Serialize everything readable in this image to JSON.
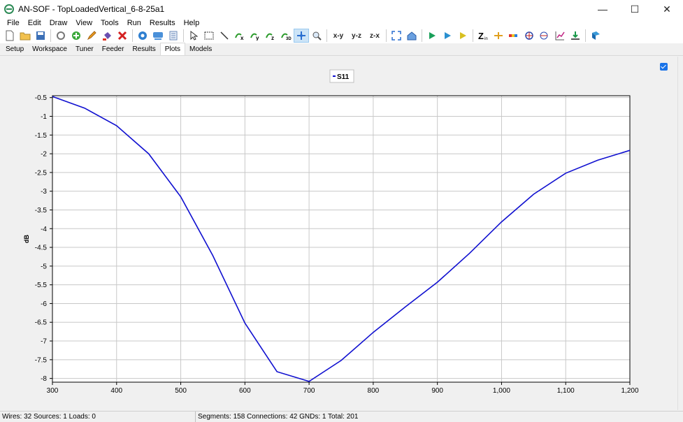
{
  "window": {
    "title": "AN-SOF - TopLoadedVertical_6-8-25a1"
  },
  "window_controls": {
    "minimize": "—",
    "maximize": "☐",
    "close": "✕"
  },
  "menu": [
    "File",
    "Edit",
    "Draw",
    "View",
    "Tools",
    "Run",
    "Results",
    "Help"
  ],
  "toolbar_text": {
    "xy": "x-y",
    "yz": "y-z",
    "zx": "z-x"
  },
  "tabs": [
    "Setup",
    "Workspace",
    "Tuner",
    "Feeder",
    "Results",
    "Plots",
    "Models"
  ],
  "active_tab": "Plots",
  "status": {
    "left": "Wires: 32  Sources: 1  Loads: 0",
    "right": "Segments: 158  Connections: 42  GNDs: 1  Total: 201"
  },
  "chart_data": {
    "type": "line",
    "title": "",
    "xlabel": "",
    "ylabel": "dB",
    "legend": "S11",
    "legend_position": "top-center",
    "grid": true,
    "xlim": [
      300,
      1200
    ],
    "ylim": [
      -8.1,
      -0.45
    ],
    "x_ticks": [
      "300",
      "400",
      "500",
      "600",
      "700",
      "800",
      "900",
      "1,000",
      "1,100",
      "1,200"
    ],
    "x_tick_values": [
      300,
      400,
      500,
      600,
      700,
      800,
      900,
      1000,
      1100,
      1200
    ],
    "y_ticks": [
      "-0.5",
      "-1",
      "-1.5",
      "-2",
      "-2.5",
      "-3",
      "-3.5",
      "-4",
      "-4.5",
      "-5",
      "-5.5",
      "-6",
      "-6.5",
      "-7",
      "-7.5",
      "-8"
    ],
    "y_tick_values": [
      -0.5,
      -1,
      -1.5,
      -2,
      -2.5,
      -3,
      -3.5,
      -4,
      -4.5,
      -5,
      -5.5,
      -6,
      -6.5,
      -7,
      -7.5,
      -8
    ],
    "series": [
      {
        "name": "S11",
        "color": "#1010d0",
        "x": [
          300,
          350,
          400,
          450,
          500,
          550,
          600,
          650,
          700,
          750,
          800,
          850,
          900,
          950,
          1000,
          1050,
          1100,
          1150,
          1200
        ],
        "values": [
          -0.47,
          -0.78,
          -1.25,
          -2.0,
          -3.15,
          -4.72,
          -6.52,
          -7.82,
          -8.08,
          -7.52,
          -6.77,
          -6.09,
          -5.43,
          -4.66,
          -3.82,
          -3.08,
          -2.52,
          -2.17,
          -1.91
        ]
      }
    ]
  }
}
